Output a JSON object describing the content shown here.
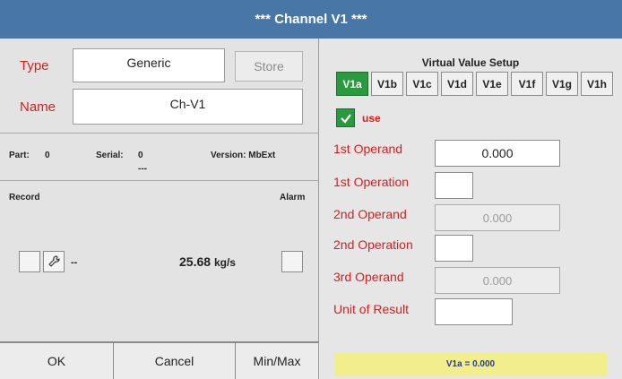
{
  "window": {
    "title": "***  Channel V1  ***"
  },
  "left": {
    "type_label": "Type",
    "type_value": "Generic",
    "store_label": "Store",
    "name_label": "Name",
    "name_value": "Ch-V1",
    "part_label": "Part:",
    "part_value": "0",
    "serial_label": "Serial:",
    "serial_value": "0",
    "serial_sub": "---",
    "version_label": "Version: MbExt",
    "record_label": "Record",
    "alarm_label": "Alarm",
    "sensor_dash": "--",
    "reading_value": "25.68",
    "reading_unit": "kg/s",
    "buttons": {
      "ok": "OK",
      "cancel": "Cancel",
      "minmax": "Min/Max"
    }
  },
  "right": {
    "header": "Virtual Value Setup",
    "tabs": [
      "V1a",
      "V1b",
      "V1c",
      "V1d",
      "V1e",
      "V1f",
      "V1g",
      "V1h"
    ],
    "active_tab": "V1a",
    "use_label": "use",
    "use_checked": true,
    "first_operand_label": "1st Operand",
    "first_operand_value": "0.000",
    "first_operation_label": "1st Operation",
    "first_operation_value": "",
    "second_operand_label": "2nd Operand",
    "second_operand_value": "0.000",
    "second_operation_label": "2nd Operation",
    "second_operation_value": "",
    "third_operand_label": "3rd Operand",
    "third_operand_value": "0.000",
    "unit_label": "Unit of Result",
    "unit_value": "",
    "result_text": "V1a = 0.000"
  },
  "colors": {
    "title_bar": "#4876a6",
    "accent_green": "#2a9a3e",
    "label_red": "#d42020",
    "result_bg": "#f2ee8c"
  }
}
